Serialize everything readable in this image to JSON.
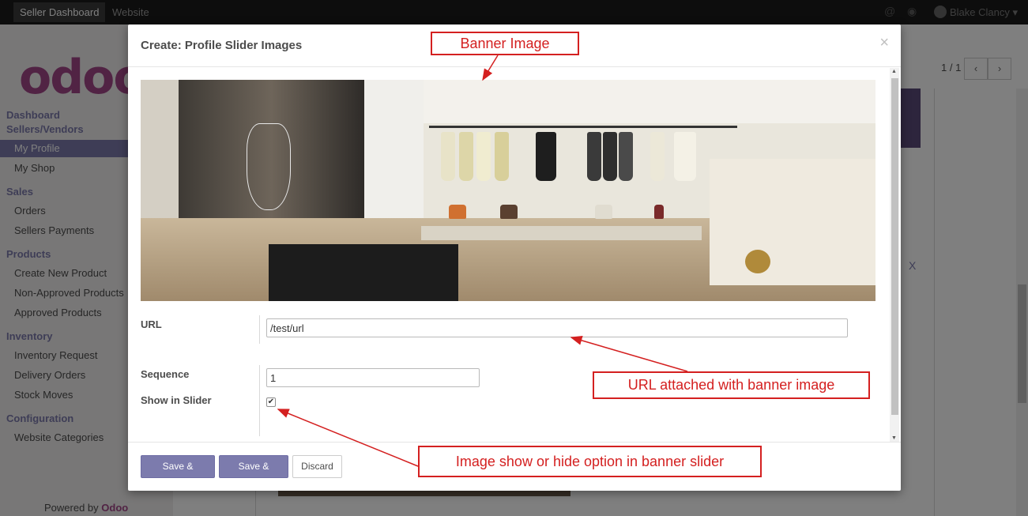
{
  "topbar": {
    "apps": [
      "Seller Dashboard",
      "Website"
    ],
    "user_name": "Blake Clancy",
    "icons": [
      "at-icon",
      "chat-icon",
      "globe-avatar-icon",
      "caret-down-icon"
    ]
  },
  "sidebar": {
    "logo_text": "odoo",
    "sections": [
      {
        "title": "Dashboard",
        "items": []
      },
      {
        "title": "Sellers/Vendors",
        "items": [
          "My Profile",
          "My Shop"
        ]
      },
      {
        "title": "Sales",
        "items": [
          "Orders",
          "Sellers Payments"
        ]
      },
      {
        "title": "Products",
        "items": [
          "Create New Product",
          "Non-Approved Products",
          "Approved Products"
        ]
      },
      {
        "title": "Inventory",
        "items": [
          "Inventory Request",
          "Delivery Orders",
          "Stock Moves"
        ]
      },
      {
        "title": "Configuration",
        "items": [
          "Website Categories"
        ]
      }
    ],
    "active_item": "My Profile",
    "powered_prefix": "Powered by",
    "powered_brand": "Odoo"
  },
  "background": {
    "pager": "1 / 1",
    "remove_label": "X"
  },
  "modal": {
    "title": "Create: Profile Slider Images",
    "close_symbol": "×",
    "fields": {
      "url_label": "URL",
      "url_value": "/test/url",
      "sequence_label": "Sequence",
      "sequence_value": "1",
      "show_in_slider_label": "Show in Slider",
      "show_in_slider_checked": true
    },
    "buttons": {
      "save_close": "Save & Close",
      "save_new": "Save & New",
      "discard": "Discard"
    }
  },
  "annotations": {
    "banner": "Banner Image",
    "url": "URL attached with banner image",
    "slider": "Image show or hide option in banner slider"
  },
  "colors": {
    "primary": "#7c7bad",
    "brand": "#a24689",
    "annotation_red": "#d42020",
    "navbar": "#1a1a1a"
  }
}
